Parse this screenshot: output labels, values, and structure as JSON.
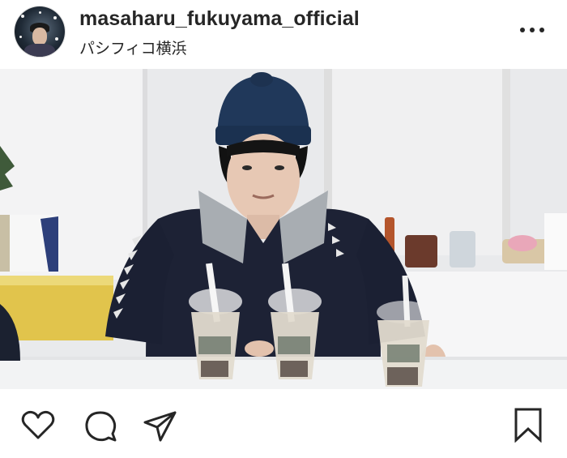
{
  "post": {
    "username": "masaharu_fukuyama_official",
    "location": "パシフィコ横浜"
  },
  "icons": {
    "more": "more-options-icon",
    "like": "heart-icon",
    "comment": "comment-icon",
    "share": "send-icon",
    "save": "bookmark-icon"
  },
  "colors": {
    "text": "#262626",
    "icon": "#262626",
    "background": "#ffffff"
  }
}
